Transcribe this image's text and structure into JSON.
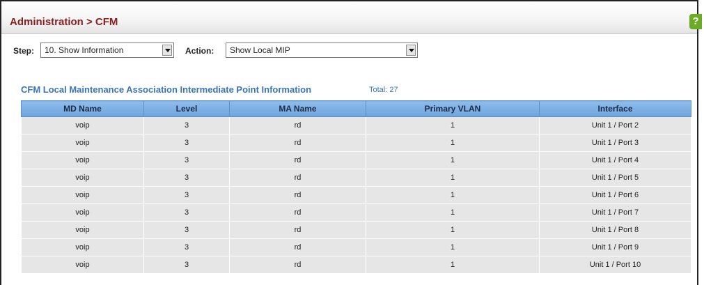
{
  "breadcrumb": "Administration > CFM",
  "help": {
    "icon": "help-icon",
    "glyph": "?"
  },
  "toolbar": {
    "step_label": "Step:",
    "step_value": "10. Show Information",
    "action_label": "Action:",
    "action_value": "Show Local MIP"
  },
  "section": {
    "title": "CFM Local Maintenance Association Intermediate Point Information",
    "total": "Total: 27"
  },
  "table": {
    "columns": [
      "MD Name",
      "Level",
      "MA Name",
      "Primary VLAN",
      "Interface"
    ],
    "rows": [
      [
        "voip",
        "3",
        "rd",
        "1",
        "Unit 1 / Port 2"
      ],
      [
        "voip",
        "3",
        "rd",
        "1",
        "Unit 1 / Port 3"
      ],
      [
        "voip",
        "3",
        "rd",
        "1",
        "Unit 1 / Port 4"
      ],
      [
        "voip",
        "3",
        "rd",
        "1",
        "Unit 1 / Port 5"
      ],
      [
        "voip",
        "3",
        "rd",
        "1",
        "Unit 1 / Port 6"
      ],
      [
        "voip",
        "3",
        "rd",
        "1",
        "Unit 1 / Port 7"
      ],
      [
        "voip",
        "3",
        "rd",
        "1",
        "Unit 1 / Port 8"
      ],
      [
        "voip",
        "3",
        "rd",
        "1",
        "Unit 1 / Port 9"
      ],
      [
        "voip",
        "3",
        "rd",
        "1",
        "Unit 1 / Port 10"
      ]
    ]
  },
  "colors": {
    "breadcrumb": "#8b1e1e",
    "section_title": "#3a73b5",
    "table_header": "#7fb2e6",
    "row_bg": "#e6e6e6",
    "help_icon": "#6cab26"
  }
}
